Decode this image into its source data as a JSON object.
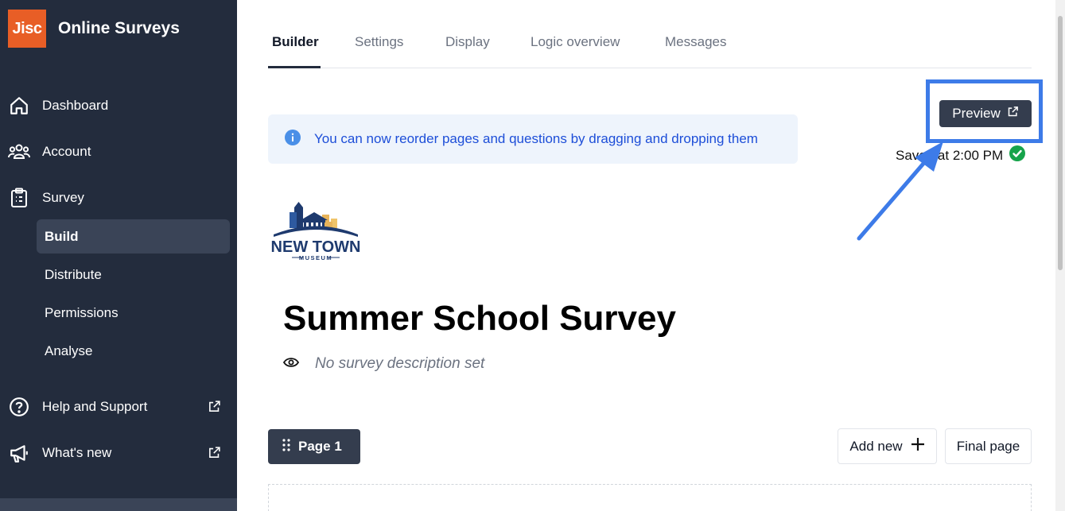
{
  "app": {
    "logo_text": "Jisc",
    "title": "Online Surveys"
  },
  "sidebar": {
    "items": [
      {
        "label": "Dashboard",
        "icon": "home-icon"
      },
      {
        "label": "Account",
        "icon": "users-icon"
      },
      {
        "label": "Survey",
        "icon": "clipboard-icon"
      }
    ],
    "sub_items": [
      {
        "label": "Build",
        "active": true
      },
      {
        "label": "Distribute"
      },
      {
        "label": "Permissions"
      },
      {
        "label": "Analyse"
      }
    ],
    "help": {
      "label": "Help and Support",
      "icon": "question-circle-icon"
    },
    "whats_new": {
      "label": "What's new",
      "icon": "megaphone-icon"
    }
  },
  "tabs": [
    {
      "label": "Builder",
      "active": true
    },
    {
      "label": "Settings"
    },
    {
      "label": "Display"
    },
    {
      "label": "Logic overview"
    },
    {
      "label": "Messages"
    }
  ],
  "toolbar": {
    "preview_label": "Preview",
    "saved_text": "Saved at 2:00 PM"
  },
  "notice": {
    "text": "You can now reorder pages and questions by dragging and dropping them"
  },
  "logo": {
    "line1": "NEW TOWN",
    "line2": "MUSEUM"
  },
  "survey": {
    "title": "Summer School Survey",
    "description_placeholder": "No survey description set"
  },
  "page_controls": {
    "page_label": "Page 1",
    "add_new_label": "Add new",
    "final_page_label": "Final page"
  },
  "colors": {
    "sidebar_bg": "#232c3d",
    "brand_orange": "#e85e26",
    "highlight_blue": "#3d7be8",
    "saved_green": "#16a34a"
  }
}
